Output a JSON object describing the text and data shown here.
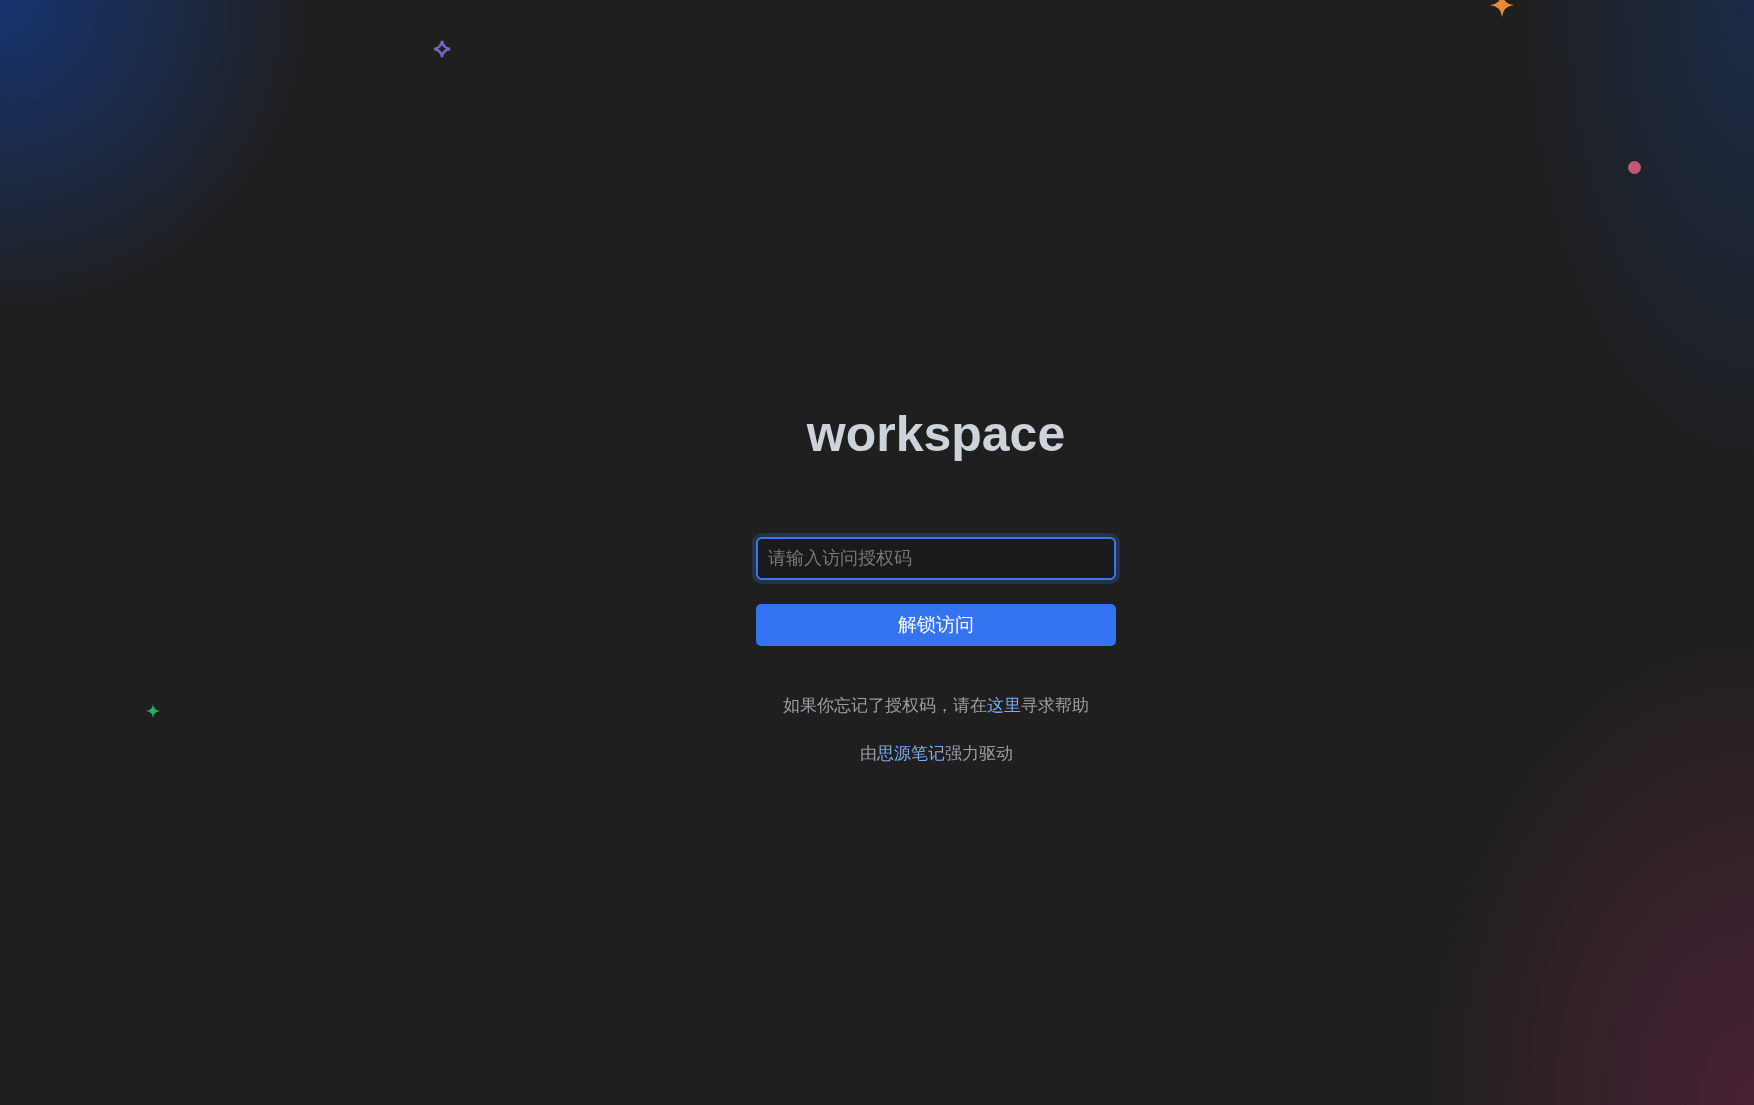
{
  "title": "workspace",
  "access_field": {
    "placeholder": "请输入访问授权码",
    "focused": true
  },
  "unlock_button": {
    "label": "解锁访问"
  },
  "help_text": {
    "before": "如果你忘记了授权码，请在",
    "link": "这里",
    "after": "寻求帮助"
  },
  "powered_by": {
    "before": "由",
    "link": "思源笔记",
    "after": "强力驱动"
  }
}
